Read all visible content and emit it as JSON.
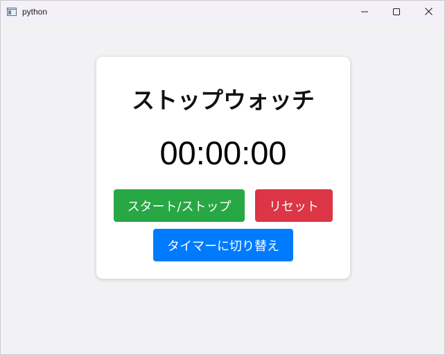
{
  "window": {
    "title": "python",
    "controls": {
      "minimize_icon": "minimize-icon",
      "maximize_icon": "maximize-icon",
      "close_icon": "close-icon"
    }
  },
  "stopwatch": {
    "title": "ストップウォッチ",
    "time": "00:00:00",
    "buttons": {
      "start_stop": "スタート/ストップ",
      "reset": "リセット",
      "switch_timer": "タイマーに切り替え"
    }
  },
  "colors": {
    "start_stop": "#28a745",
    "reset": "#dc3545",
    "switch_timer": "#007bff",
    "background": "#f2f2f4",
    "card": "#ffffff"
  }
}
